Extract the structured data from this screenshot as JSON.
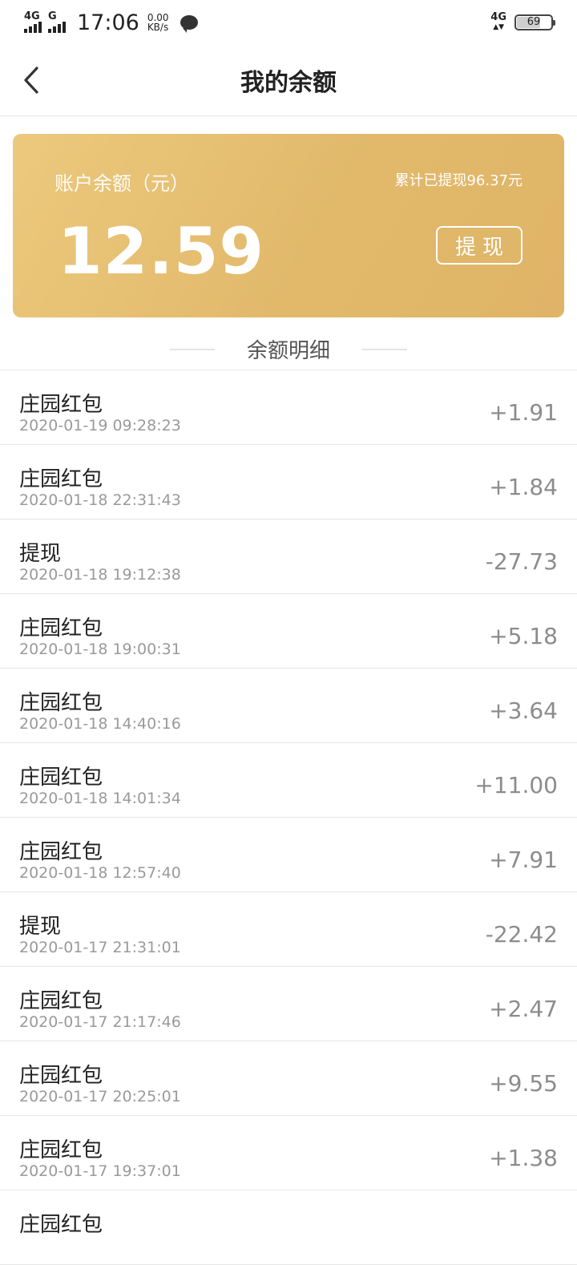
{
  "status_bar": {
    "network1": "4G",
    "network2": "G",
    "time": "17:06",
    "speed_value": "0.00",
    "speed_unit": "KB/s",
    "network_right": "4G",
    "battery": "69"
  },
  "nav": {
    "title": "我的余额"
  },
  "balance_card": {
    "label": "账户余额（元）",
    "withdrawn_total": "累计已提现96.37元",
    "amount": "12.59",
    "withdraw_button": "提现"
  },
  "details": {
    "section_title": "余额明细",
    "transactions": [
      {
        "title": "庄园红包",
        "time": "2020-01-19 09:28:23",
        "amount": "+1.91"
      },
      {
        "title": "庄园红包",
        "time": "2020-01-18 22:31:43",
        "amount": "+1.84"
      },
      {
        "title": "提现",
        "time": "2020-01-18 19:12:38",
        "amount": "-27.73"
      },
      {
        "title": "庄园红包",
        "time": "2020-01-18 19:00:31",
        "amount": "+5.18"
      },
      {
        "title": "庄园红包",
        "time": "2020-01-18 14:40:16",
        "amount": "+3.64"
      },
      {
        "title": "庄园红包",
        "time": "2020-01-18 14:01:34",
        "amount": "+11.00"
      },
      {
        "title": "庄园红包",
        "time": "2020-01-18 12:57:40",
        "amount": "+7.91"
      },
      {
        "title": "提现",
        "time": "2020-01-17 21:31:01",
        "amount": "-22.42"
      },
      {
        "title": "庄园红包",
        "time": "2020-01-17 21:17:46",
        "amount": "+2.47"
      },
      {
        "title": "庄园红包",
        "time": "2020-01-17 20:25:01",
        "amount": "+9.55"
      },
      {
        "title": "庄园红包",
        "time": "2020-01-17 19:37:01",
        "amount": "+1.38"
      },
      {
        "title": "庄园红包",
        "time": "",
        "amount": ""
      }
    ]
  }
}
